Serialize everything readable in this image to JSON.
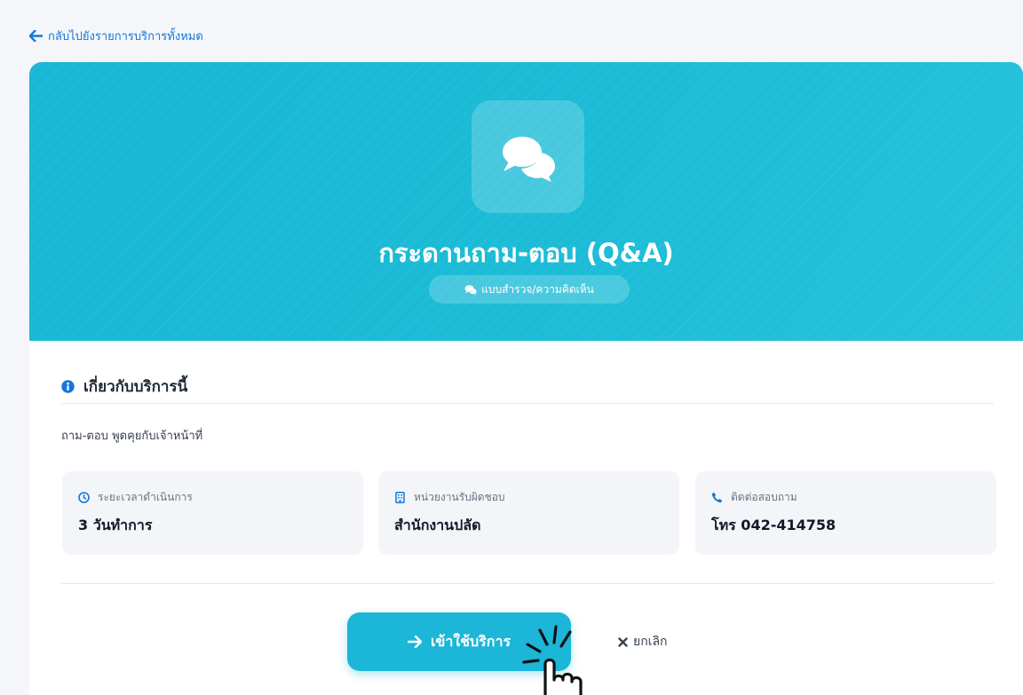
{
  "nav": {
    "back_label": "กลับไปยังรายการบริการทั้งหมด"
  },
  "hero": {
    "title": "กระดานถาม-ตอบ (Q&A)",
    "category_badge": "แบบสำรวจ/ความคิดเห็น",
    "icon": "comments-icon"
  },
  "about": {
    "title": "เกี่ยวกับบริการนี้",
    "description": "ถาม-ตอบ พูดคุยกับเจ้าหน้าที่"
  },
  "info_cards": [
    {
      "label": "ระยะเวลาดำเนินการ",
      "value": "3 วันทำการ",
      "icon": "clock-icon"
    },
    {
      "label": "หน่วยงานรับผิดชอบ",
      "value": "สำนักงานปลัด",
      "icon": "building-icon"
    },
    {
      "label": "ติดต่อสอบถาม",
      "value": "โทร 042-414758",
      "icon": "phone-icon"
    }
  ],
  "actions": {
    "primary_label": "เข้าใช้บริการ",
    "cancel_label": "ยกเลิก"
  },
  "colors": {
    "accent": "#1cb6d8",
    "link": "#1577d6",
    "hero_bg": "#1cbcd7"
  }
}
